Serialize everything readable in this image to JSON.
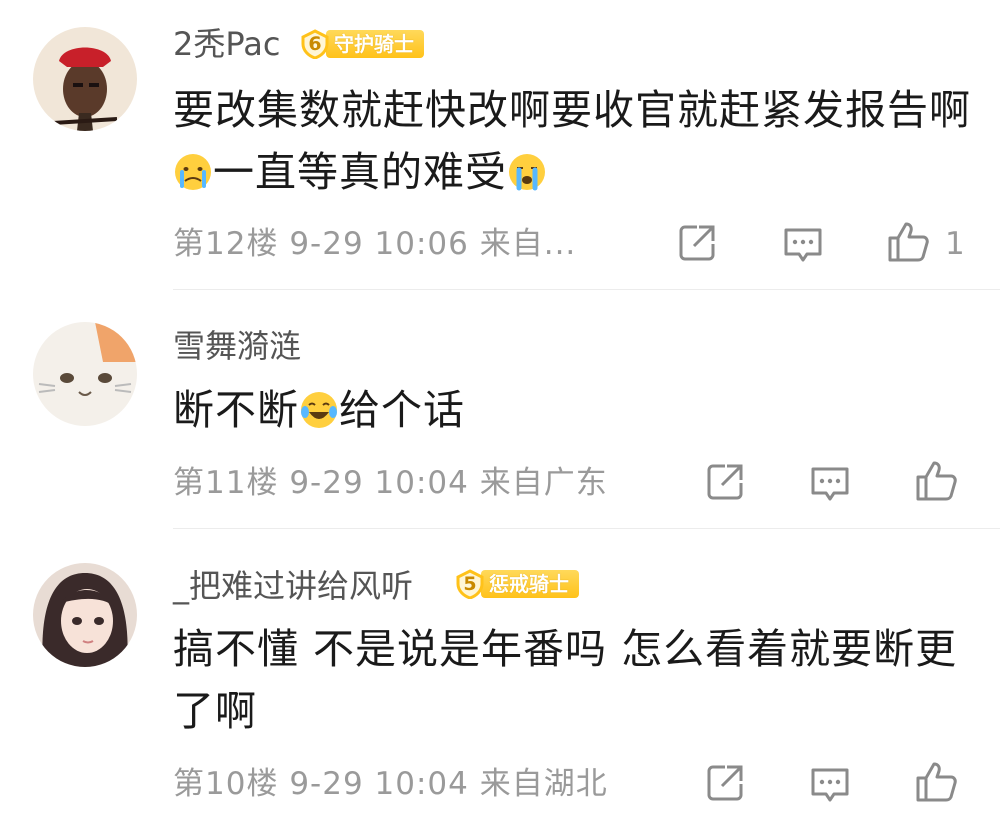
{
  "comments": [
    {
      "username": "2秃Pac",
      "badge": {
        "level": "6",
        "title": "守护骑士"
      },
      "content_line1": "要改集数就赶快改啊要收官就赶紧发报告啊",
      "content_line2": "一直等真的难受",
      "floor": "第12楼",
      "time": "9-29 10:06",
      "location": "来自...",
      "likes": "1",
      "icons": [
        "share-icon",
        "comment-icon",
        "like-icon"
      ]
    },
    {
      "username": "雪舞漪涟",
      "content_pre": "断不断",
      "content_post": "给个话",
      "floor": "第11楼",
      "time": "9-29 10:04",
      "location": "来自广东",
      "icons": [
        "share-icon",
        "comment-icon",
        "like-icon"
      ]
    },
    {
      "username": "_把难过讲给风听",
      "badge": {
        "level": "5",
        "title": "惩戒骑士"
      },
      "content_line1": "搞不懂 不是说是年番吗 怎么看着就要断更",
      "content_line2": "了啊",
      "floor": "第10楼",
      "time": "9-29 10:04",
      "location": "来自湖北",
      "icons": [
        "share-icon",
        "comment-icon",
        "like-icon"
      ]
    }
  ],
  "colors": {
    "badge": "#ffc21a",
    "meta_text": "#9a9a9a",
    "text": "#1a1a1a"
  }
}
